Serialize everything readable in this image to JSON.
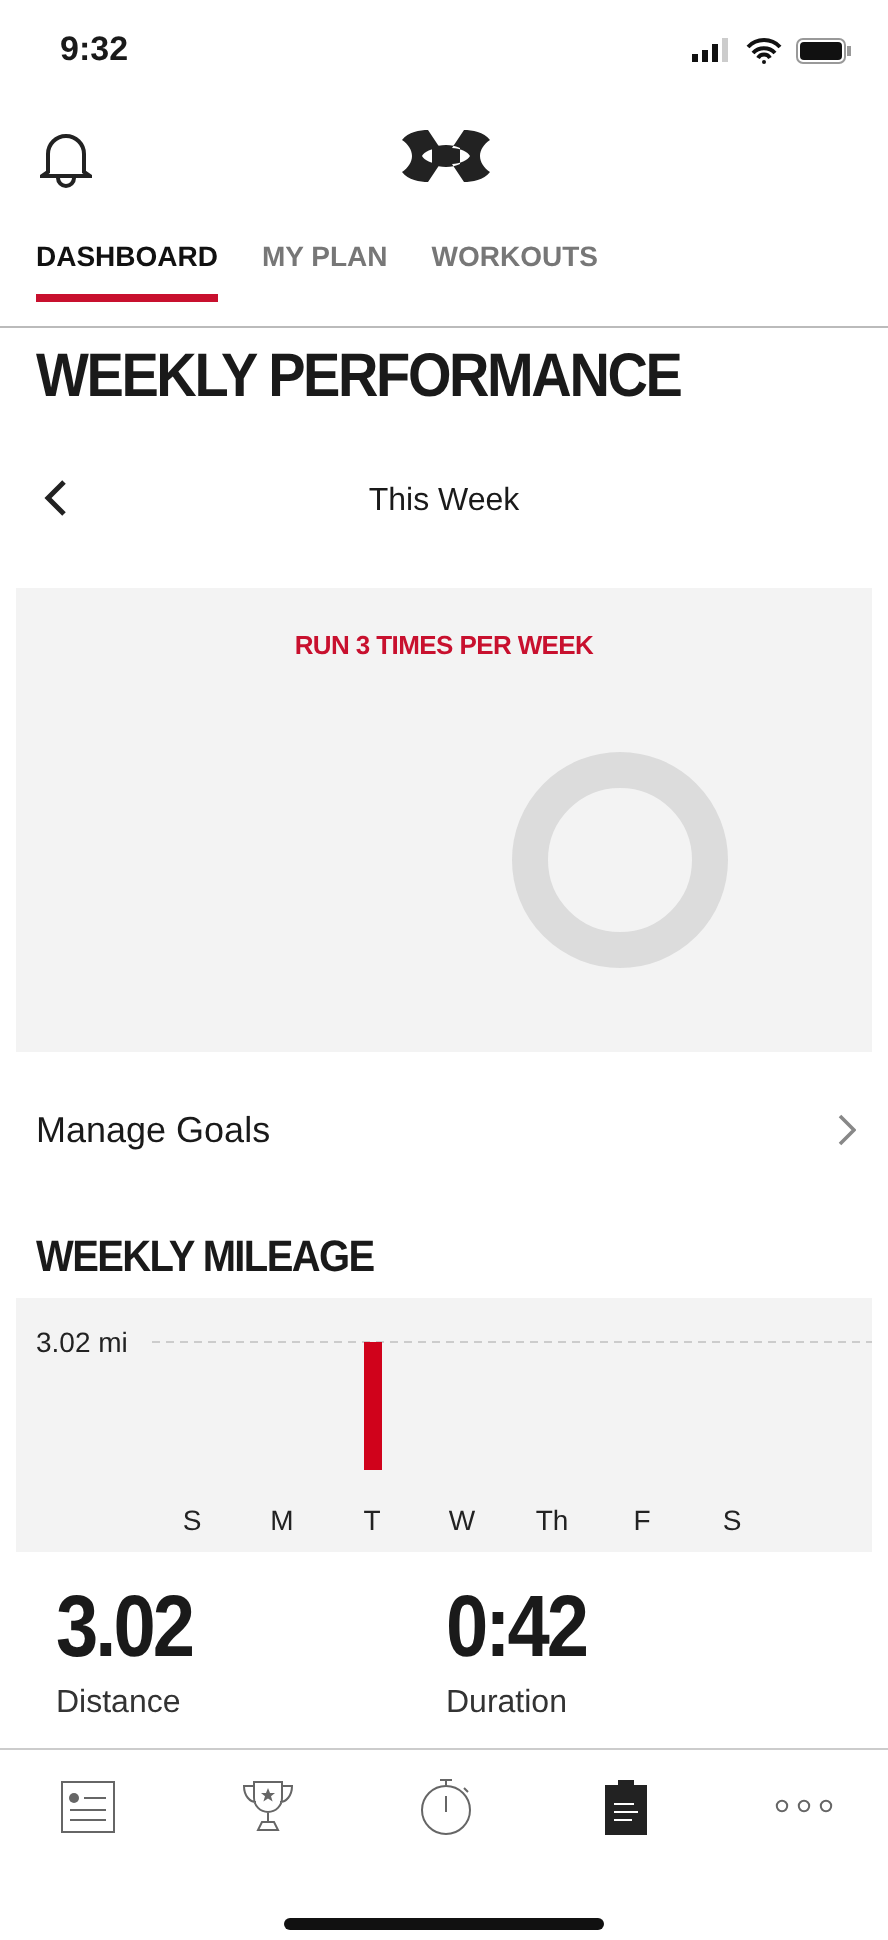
{
  "status_bar": {
    "time": "9:32"
  },
  "tabs": [
    {
      "label": "DASHBOARD",
      "selected": true
    },
    {
      "label": "MY PLAN",
      "selected": false
    },
    {
      "label": "WORKOUTS",
      "selected": false
    }
  ],
  "page_title": "WEEKLY PERFORMANCE",
  "period": {
    "label": "This Week"
  },
  "goal_card": {
    "title": "RUN 3 TIMES PER WEEK",
    "level": 0
  },
  "manage_goals": "Manage Goals",
  "mileage": {
    "title": "WEEKLY MILEAGE",
    "chart_data": {
      "type": "bar",
      "categories": [
        "S",
        "M",
        "T",
        "W",
        "Th",
        "F",
        "S"
      ],
      "values": [
        0,
        0,
        3.02,
        0,
        0,
        0,
        0
      ],
      "ylim": [
        0,
        3.02
      ],
      "yticks": [
        {
          "value": 3.02,
          "label": "3.02 mi"
        }
      ]
    }
  },
  "stats": [
    {
      "value": "3.02",
      "label": "Distance"
    },
    {
      "value": "0:42",
      "label": "Duration"
    }
  ],
  "bottom_nav": [
    {
      "kind": "feed",
      "selected": false
    },
    {
      "kind": "trophy",
      "selected": false
    },
    {
      "kind": "stopwatch",
      "selected": false
    },
    {
      "kind": "plan",
      "selected": true
    },
    {
      "kind": "more",
      "selected": false
    }
  ]
}
